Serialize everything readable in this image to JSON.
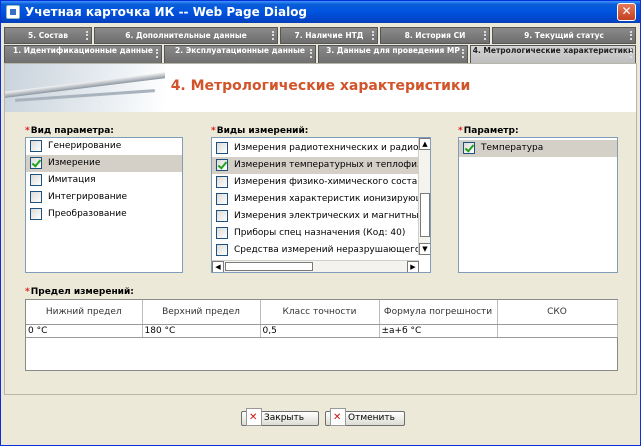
{
  "window": {
    "title": "Учетная карточка ИК -- Web Page Dialog",
    "close_glyph": "✕"
  },
  "tabs_row1": [
    "5. Состав",
    "6. Дополнительные данные",
    "7. Наличие НТД",
    "8. История СИ",
    "9. Текущий статус"
  ],
  "tabs_row2": [
    "1. Идентификационные данные",
    "2. Эксплуатационные данные",
    "3. Данные для проведения МР",
    "4. Метрологические характеристики"
  ],
  "page_title": "4. Метрологические характеристики",
  "param_kind": {
    "label": "Вид параметра:",
    "items": [
      {
        "label": "Генерирование",
        "checked": false,
        "selected": false
      },
      {
        "label": "Измерение",
        "checked": true,
        "selected": true
      },
      {
        "label": "Имитация",
        "checked": false,
        "selected": false
      },
      {
        "label": "Интегрирование",
        "checked": false,
        "selected": false
      },
      {
        "label": "Преобразование",
        "checked": false,
        "selected": false
      }
    ]
  },
  "measure_kinds": {
    "label": "Виды измерений:",
    "items": [
      {
        "label": "Измерения радиотехнических и радиоэ",
        "checked": false,
        "selected": false
      },
      {
        "label": "Измерения температурных и теплофиз",
        "checked": true,
        "selected": true
      },
      {
        "label": "Измерения физико-химического состав",
        "checked": false,
        "selected": false
      },
      {
        "label": "Измерения характеристик ионизирующ",
        "checked": false,
        "selected": false
      },
      {
        "label": "Измерения электрических и магнитных",
        "checked": false,
        "selected": false
      },
      {
        "label": "Приборы спец назначения (Код: 40)",
        "checked": false,
        "selected": false
      },
      {
        "label": "Средства измерений неразрушающего",
        "checked": false,
        "selected": false
      }
    ]
  },
  "parameter": {
    "label": "Параметр:",
    "items": [
      {
        "label": "Температура",
        "checked": true,
        "selected": true
      }
    ]
  },
  "limit": {
    "label": "Предел измерений:",
    "columns": [
      "Нижний предел",
      "Верхний предел",
      "Класс точности",
      "Формула погрешности",
      "СКО"
    ],
    "rows": [
      [
        "0 °C",
        "180 °C",
        "0,5",
        "±a+б °C",
        ""
      ]
    ]
  },
  "buttons": {
    "close": "Закрыть",
    "cancel": "Отменить"
  },
  "colors": {
    "title_bar": "#0053e0",
    "accent_title": "#d2542a",
    "required_star": "#e0201d",
    "check": "#21a121"
  }
}
